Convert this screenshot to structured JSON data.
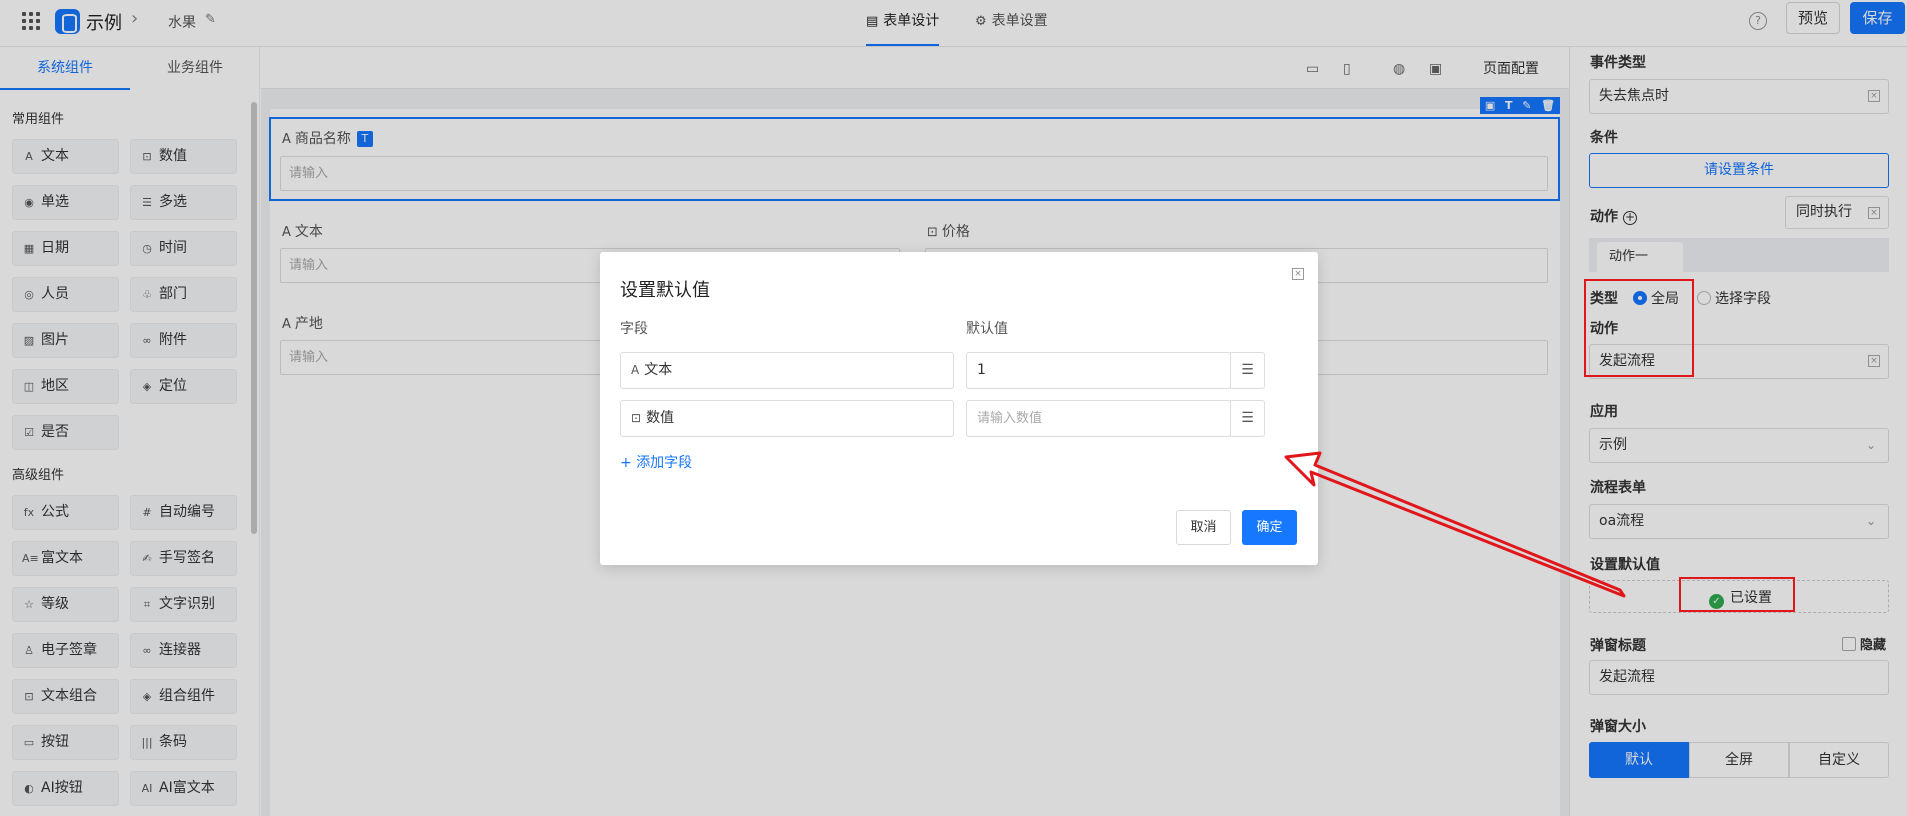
{
  "header": {
    "app_name": "示例",
    "breadcrumb": "水果",
    "tabs": [
      {
        "label": "表单设计",
        "active": true
      },
      {
        "label": "表单设置",
        "active": false
      }
    ],
    "help": "?",
    "preview_label": "预览",
    "save_label": "保存"
  },
  "left_panel": {
    "tabs": [
      {
        "label": "系统组件",
        "active": true
      },
      {
        "label": "业务组件",
        "active": false
      }
    ],
    "common_title": "常用组件",
    "common_items": [
      {
        "label": "文本",
        "icon": "text-icon"
      },
      {
        "label": "数值",
        "icon": "number-icon"
      },
      {
        "label": "单选",
        "icon": "radio-icon"
      },
      {
        "label": "多选",
        "icon": "checklist-icon"
      },
      {
        "label": "日期",
        "icon": "calendar-icon"
      },
      {
        "label": "时间",
        "icon": "clock-icon"
      },
      {
        "label": "人员",
        "icon": "user-icon"
      },
      {
        "label": "部门",
        "icon": "org-icon"
      },
      {
        "label": "图片",
        "icon": "image-icon"
      },
      {
        "label": "附件",
        "icon": "link-icon"
      },
      {
        "label": "地区",
        "icon": "map-icon"
      },
      {
        "label": "定位",
        "icon": "location-icon"
      },
      {
        "label": "是否",
        "icon": "checkbox-icon"
      }
    ],
    "advanced_title": "高级组件",
    "advanced_items": [
      {
        "label": "公式",
        "icon": "fx-icon"
      },
      {
        "label": "自动编号",
        "icon": "hash-icon"
      },
      {
        "label": "富文本",
        "icon": "richtext-icon"
      },
      {
        "label": "手写签名",
        "icon": "signature-icon"
      },
      {
        "label": "等级",
        "icon": "star-icon"
      },
      {
        "label": "文字识别",
        "icon": "ocr-icon"
      },
      {
        "label": "电子签章",
        "icon": "stamp-icon"
      },
      {
        "label": "连接器",
        "icon": "connector-icon"
      },
      {
        "label": "文本组合",
        "icon": "text-combo-icon"
      },
      {
        "label": "组合组件",
        "icon": "combo-icon"
      },
      {
        "label": "按钮",
        "icon": "button-icon"
      },
      {
        "label": "条码",
        "icon": "barcode-icon"
      },
      {
        "label": "AI按钮",
        "icon": "ai-button-icon"
      },
      {
        "label": "AI富文本",
        "icon": "ai-richtext-icon"
      }
    ]
  },
  "canvas": {
    "page_config_label": "页面配置",
    "fields": [
      {
        "label": "商品名称",
        "placeholder": "请输入",
        "selected": true
      },
      {
        "label": "文本",
        "placeholder": "请输入"
      },
      {
        "label": "价格",
        "placeholder": ""
      },
      {
        "label": "产地",
        "placeholder": "请输入"
      }
    ]
  },
  "right_panel": {
    "event_type_label": "事件类型",
    "event_type_value": "失去焦点时",
    "condition_label": "条件",
    "condition_button": "请设置条件",
    "action_label": "动作",
    "concurrent_value": "同时执行",
    "action_tab": "动作一",
    "type_label": "类型",
    "type_options": [
      {
        "label": "全局",
        "checked": true
      },
      {
        "label": "选择字段",
        "checked": false
      }
    ],
    "action_sub_label": "动作",
    "action_value": "发起流程",
    "app_label": "应用",
    "app_value": "示例",
    "flow_form_label": "流程表单",
    "flow_form_value": "oa流程",
    "default_label": "设置默认值",
    "default_status": "已设置",
    "popup_title_label": "弹窗标题",
    "hide_label": "隐藏",
    "popup_title_value": "发起流程",
    "popup_size_label": "弹窗大小",
    "popup_size_options": [
      {
        "label": "默认",
        "active": true
      },
      {
        "label": "全屏",
        "active": false
      },
      {
        "label": "自定义",
        "active": false
      }
    ]
  },
  "dialog": {
    "title": "设置默认值",
    "col_field": "字段",
    "col_default": "默认值",
    "rows": [
      {
        "field": "文本",
        "value": "1",
        "placeholder": ""
      },
      {
        "field": "数值",
        "value": "",
        "placeholder": "请输入数值"
      }
    ],
    "add_field": "添加字段",
    "cancel": "取消",
    "confirm": "确定"
  },
  "colors": {
    "accent": "#1677ff",
    "annotation": "#e0161b",
    "success": "#2eaa4f"
  }
}
